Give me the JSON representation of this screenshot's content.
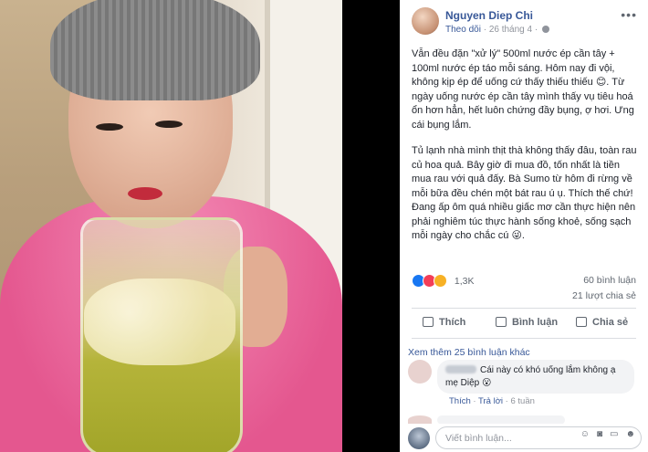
{
  "post": {
    "author": "Nguyen Diep Chi",
    "follow_label": "Theo dõi",
    "date": "26 tháng 4",
    "paragraph1": "Vẫn đều đặn \"xử lý\" 500ml nước ép cần tây + 100ml nước ép táo mỗi sáng. Hôm nay đi vội, không kịp ép để uống cứ thấy thiếu thiếu 😊. Từ ngày uống nước ép cần tây mình thấy vụ tiêu hoá ổn hơn hẳn, hết luôn chứng đầy bụng, ợ hơi. Ưng cái bụng lắm.",
    "paragraph2": "Tủ lạnh nhà mình thịt thà không thấy đâu, toàn rau củ hoa quả. Bây giờ đi mua đồ, tốn nhất là tiền mua rau với quả đấy. Bà Sumo từ hôm đi rừng về mỗi bữa đều chén một bát rau ú ụ. Thích thế chứ! Đang ấp ôm quá nhiều giấc mơ cần thực hiện nên phải nghiêm túc thực hành sống khoẻ, sống sạch mỗi ngày cho chắc cú 😜."
  },
  "stats": {
    "reactions_count": "1,3K",
    "comments": "60 bình luận",
    "shares": "21 lượt chia sẻ"
  },
  "actions": {
    "like": "Thích",
    "comment": "Bình luận",
    "share": "Chia sẻ"
  },
  "comments": {
    "see_more": "Xem thêm 25 bình luận khác",
    "first_text": "Cái này có khó uống lắm không ạ mẹ Diệp 😮",
    "like": "Thích",
    "reply": "Trả lời",
    "time": "6 tuần",
    "separator": " · "
  },
  "composer": {
    "placeholder": "Viết bình luận..."
  },
  "icons": [
    "more-icon",
    "globe-icon",
    "like-icon",
    "comment-icon",
    "share-icon",
    "camera-icon",
    "gif-icon",
    "sticker-icon"
  ],
  "colors": {
    "link": "#385898",
    "muted": "#90949c",
    "like": "#1877f2",
    "love": "#f33e58",
    "haha": "#f7b125"
  }
}
